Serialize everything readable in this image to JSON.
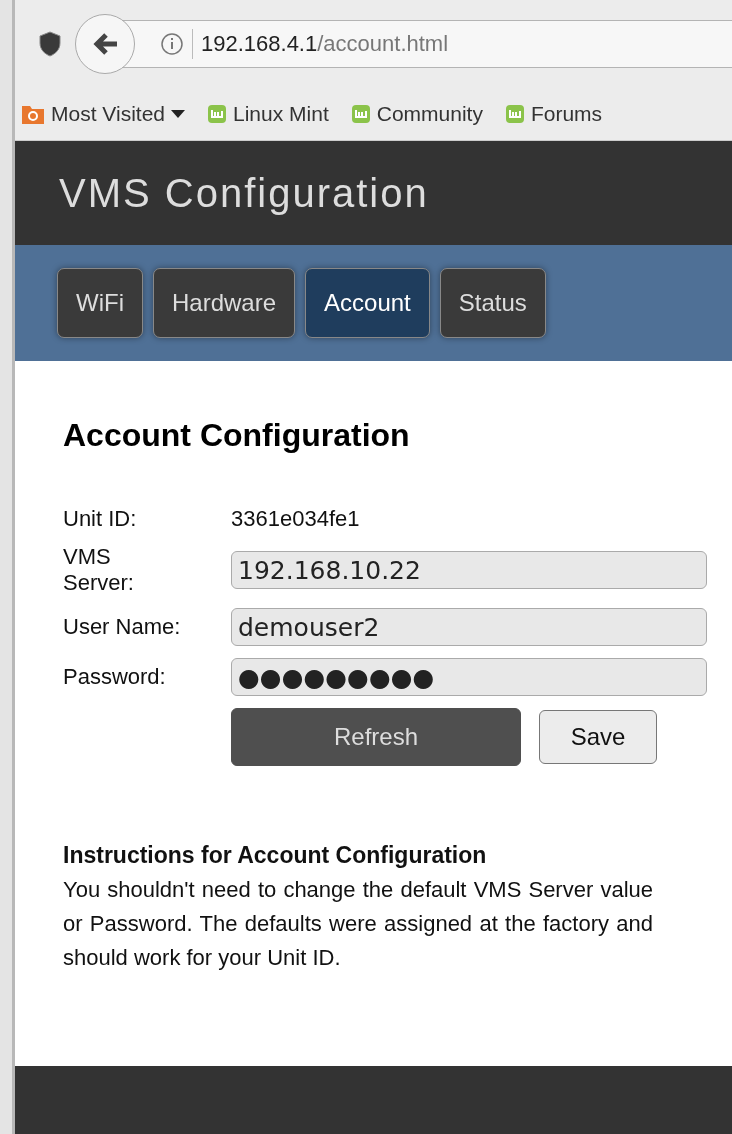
{
  "browser": {
    "url_host": "192.168.4.1",
    "url_path": "/account.html",
    "bookmarks": [
      {
        "label": "Most Visited",
        "kind": "folder"
      },
      {
        "label": "Linux Mint",
        "kind": "site"
      },
      {
        "label": "Community",
        "kind": "site"
      },
      {
        "label": "Forums",
        "kind": "site"
      }
    ]
  },
  "header": {
    "title": "VMS Configuration"
  },
  "tabs": [
    {
      "label": "WiFi",
      "selected": false
    },
    {
      "label": "Hardware",
      "selected": false
    },
    {
      "label": "Account",
      "selected": true
    },
    {
      "label": "Status",
      "selected": false
    }
  ],
  "heading": "Account Configuration",
  "unit_id": {
    "label": "Unit ID:",
    "value": "3361e034fe1"
  },
  "fields": [
    {
      "label": "VMS Server:",
      "value": "192.168.10.22"
    },
    {
      "label": "User Name:",
      "value": "demouser2"
    },
    {
      "label": "Password:",
      "value": "●●●●●●●●●"
    }
  ],
  "buttons": [
    {
      "label": "Refresh",
      "kind": "dark"
    },
    {
      "label": "Save",
      "kind": "light"
    }
  ],
  "instructions": {
    "title": "Instructions for Account Configuration",
    "text": "You shouldn't need to change the default VMS Server value or Password. The defaults were assigned at the factory and should work for your Unit ID."
  }
}
